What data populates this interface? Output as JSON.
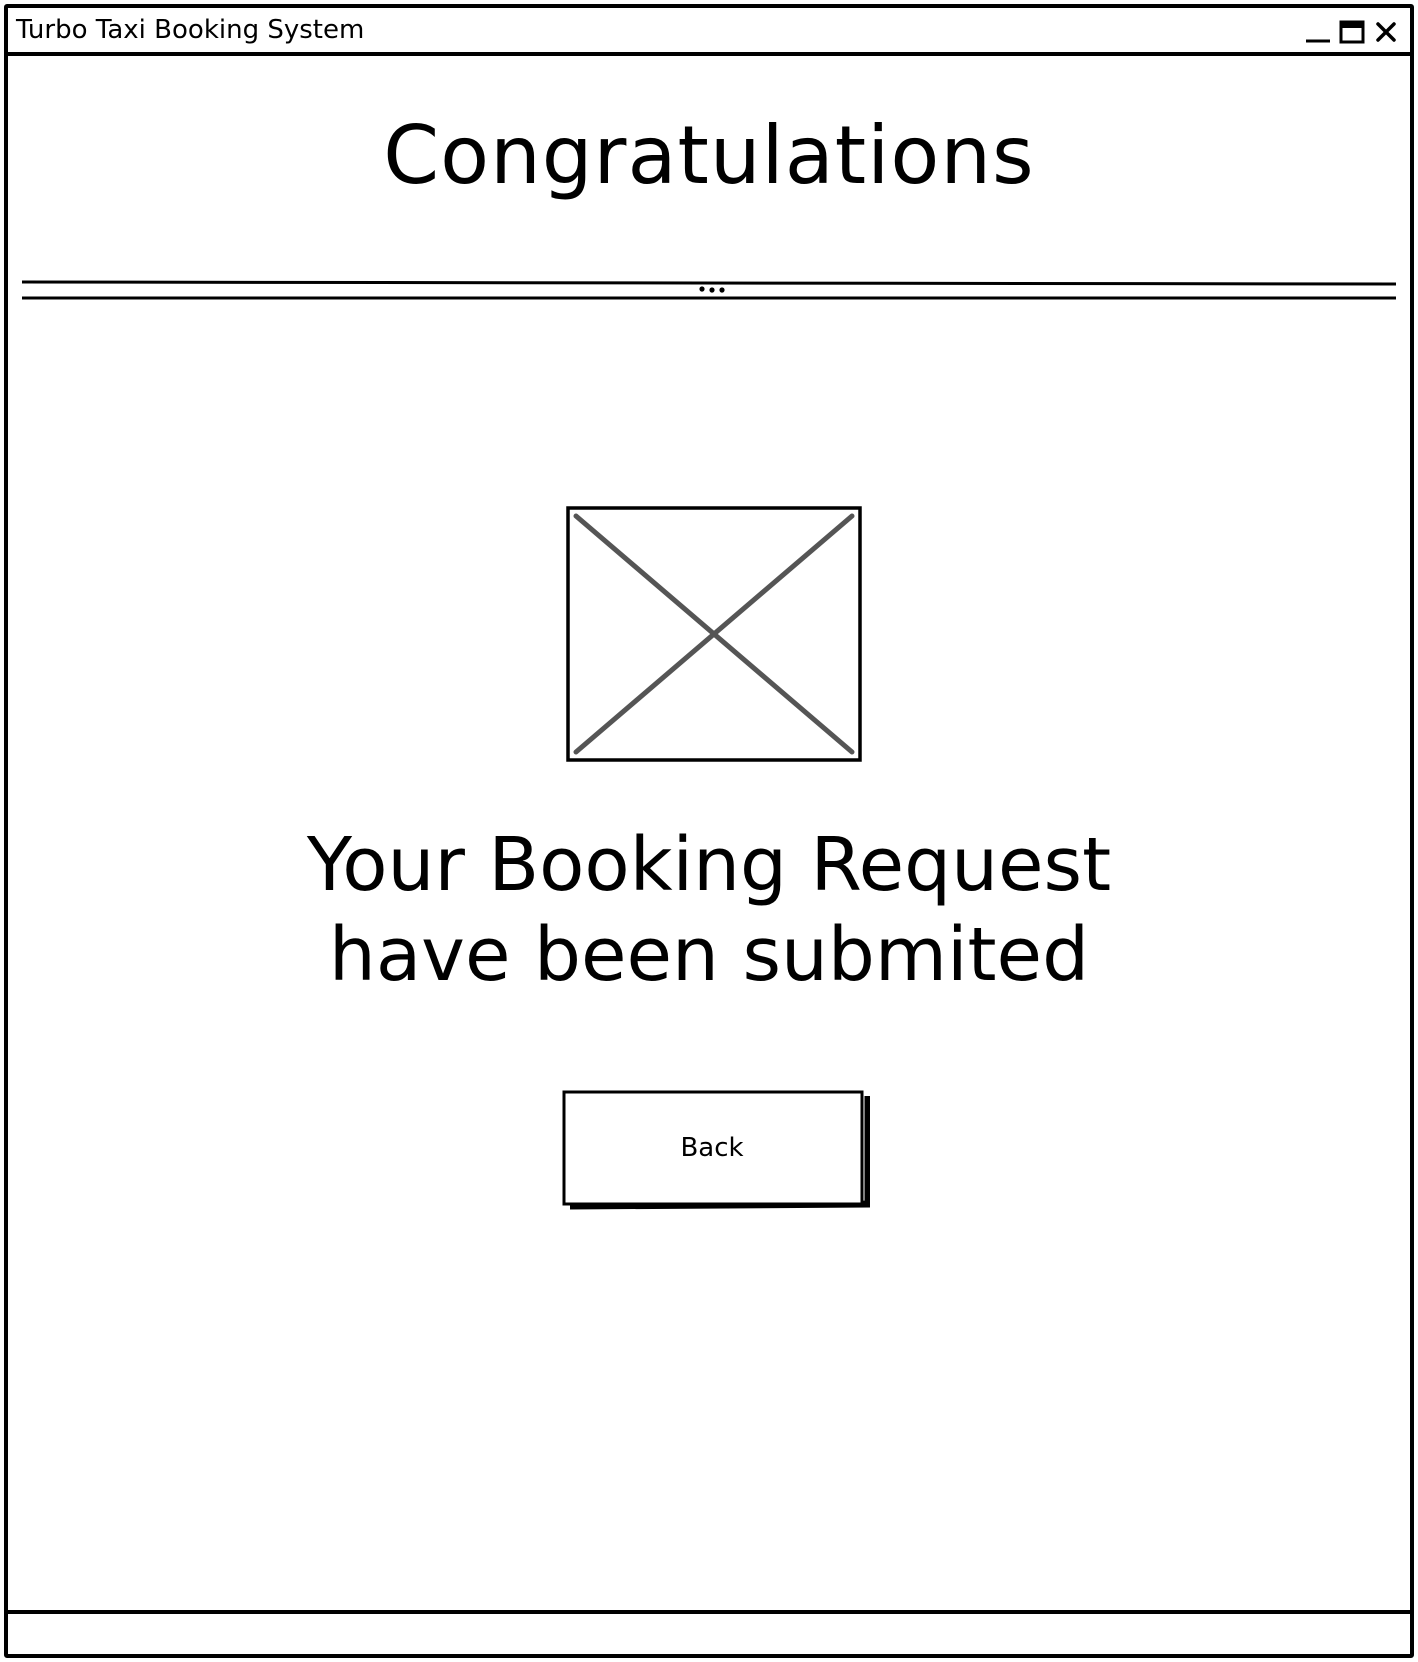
{
  "window": {
    "title": "Turbo Taxi Booking System",
    "controls": {
      "minimize_icon": "minimize-icon",
      "maximize_icon": "maximize-icon",
      "close_icon": "close-icon"
    }
  },
  "main": {
    "heading": "Congratulations",
    "image": {
      "icon": "image-placeholder-icon"
    },
    "message": "Your Booking Request\nhave been submited",
    "back_button_label": "Back"
  },
  "colors": {
    "stroke": "#000000",
    "placeholder_cross": "#555555",
    "background": "#ffffff"
  }
}
